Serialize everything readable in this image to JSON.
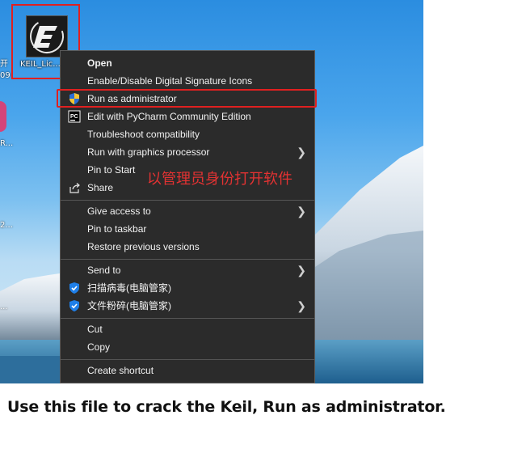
{
  "desktop": {
    "left_fragments": [
      "开",
      "09",
      "R...",
      "2...",
      "..."
    ],
    "shortcut_label": "KEIL_Lic..."
  },
  "context_menu": {
    "items": [
      {
        "label": "Open",
        "bold": true
      },
      {
        "label": "Enable/Disable Digital Signature Icons"
      },
      {
        "label": "Run as administrator",
        "icon": "shield-icon",
        "highlighted": true
      },
      {
        "label": "Edit with PyCharm Community Edition",
        "icon": "pycharm-icon"
      },
      {
        "label": "Troubleshoot compatibility"
      },
      {
        "label": "Run with graphics processor",
        "submenu": true
      },
      {
        "label": "Pin to Start"
      },
      {
        "label": "Share",
        "icon": "share-icon"
      },
      {
        "label": "Give access to",
        "submenu": true
      },
      {
        "label": "Pin to taskbar"
      },
      {
        "label": "Restore previous versions"
      },
      {
        "label": "Send to",
        "submenu": true
      },
      {
        "label": "扫描病毒(电脑管家)",
        "icon": "tencent-shield-icon"
      },
      {
        "label": "文件粉碎(电脑管家)",
        "icon": "tencent-shield-icon",
        "submenu": true
      },
      {
        "label": "Cut"
      },
      {
        "label": "Copy"
      },
      {
        "label": "Create shortcut"
      }
    ]
  },
  "annotation": "以管理员身份打开软件",
  "caption": "Use this file to crack the Keil, Run as administrator.",
  "colors": {
    "highlight_border": "#e02020",
    "menu_bg": "#2b2b2b",
    "annotation": "#e33232"
  }
}
